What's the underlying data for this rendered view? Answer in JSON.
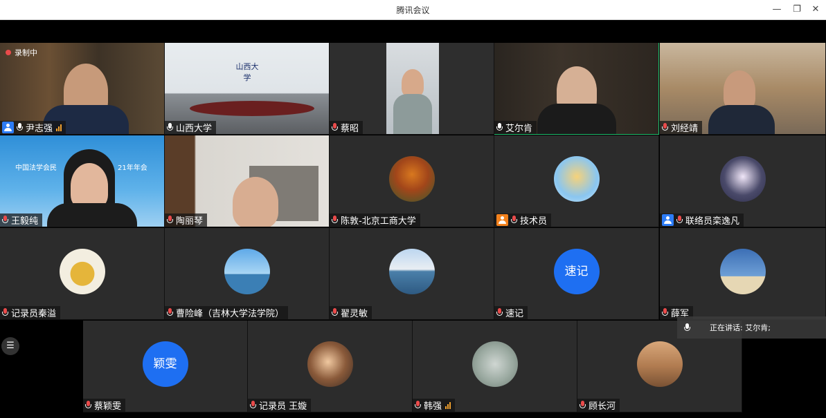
{
  "window": {
    "title": "腾讯会议",
    "minimize": "—",
    "restore": "❐",
    "close": "✕"
  },
  "recording": {
    "label": "录制中"
  },
  "speaking": {
    "text": "正在讲话: 艾尔肯;"
  },
  "colors": {
    "accent": "#1e6ff2",
    "active_speaker_border": "#1fbf6e",
    "recording": "#e94b4b",
    "badge_host": "#2d7cf6",
    "badge_cohost": "#f2811d"
  },
  "participants": {
    "p1": {
      "name": "尹志强",
      "badge": "host",
      "muted": false,
      "signal": true
    },
    "p2": {
      "name": "山西大学",
      "muted": false,
      "screen_text": "山西大学"
    },
    "p3": {
      "name": "蔡昭",
      "muted": true
    },
    "p4": {
      "name": "艾尔肯",
      "muted": false,
      "active": true
    },
    "p5": {
      "name": "刘经靖",
      "muted": true
    },
    "p6": {
      "name": "王毅纯",
      "muted": true,
      "banner_left": "中国法学会民",
      "banner_right": "21年年会"
    },
    "p7": {
      "name": "陶丽琴",
      "muted": true
    },
    "p8": {
      "name": "陈敦-北京工商大学",
      "muted": true
    },
    "p9": {
      "name": "技术员",
      "badge": "cohost",
      "muted": true
    },
    "p10": {
      "name": "联络员栾逸凡",
      "badge": "host",
      "muted": true
    },
    "p11": {
      "name": "记录员秦溢",
      "muted": true
    },
    "p12": {
      "name": "曹险峰（吉林大学法学院）",
      "muted": true
    },
    "p13": {
      "name": "翟灵敏",
      "muted": true
    },
    "p14": {
      "name": "速记",
      "muted": true,
      "avatar_text": "速记"
    },
    "p15": {
      "name": "薛军",
      "muted": true
    },
    "p16": {
      "name": "蔡颖雯",
      "muted": true,
      "avatar_text": "颖雯"
    },
    "p17": {
      "name": "记录员 王嫙",
      "muted": true
    },
    "p18": {
      "name": "韩强",
      "muted": true,
      "signal": true
    },
    "p19": {
      "name": "顾长河",
      "muted": true
    }
  }
}
